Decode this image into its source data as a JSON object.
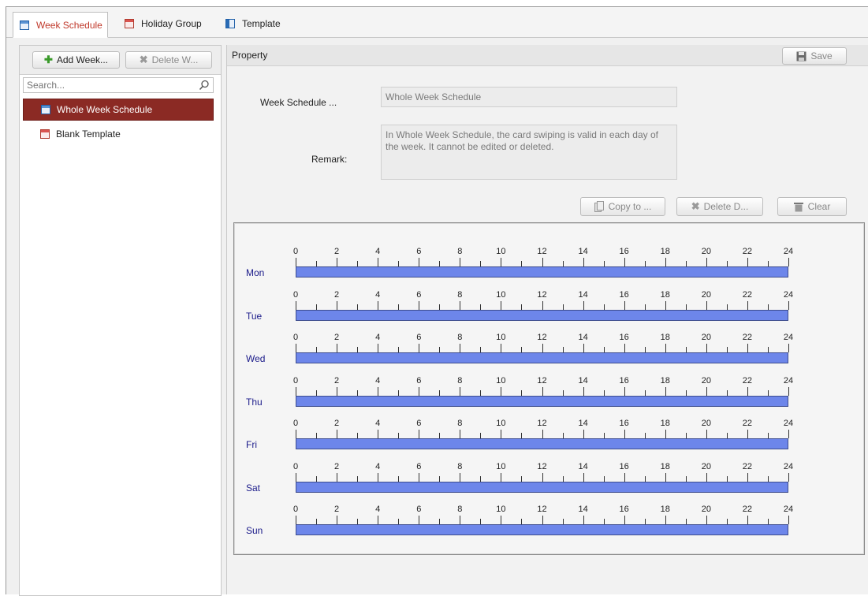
{
  "tabs": [
    {
      "label": "Week Schedule",
      "icon": "calendar-icon",
      "active": true
    },
    {
      "label": "Holiday Group",
      "icon": "holiday-calendar-icon",
      "active": false
    },
    {
      "label": "Template",
      "icon": "template-icon",
      "active": false
    }
  ],
  "left_panel": {
    "add_button": "Add Week...",
    "delete_button": "Delete W...",
    "search_placeholder": "Search...",
    "items": [
      {
        "label": "Whole Week Schedule",
        "selected": true
      },
      {
        "label": "Blank Template",
        "selected": false
      }
    ]
  },
  "property": {
    "title": "Property",
    "save_label": "Save",
    "name_label": "Week Schedule ...",
    "name_value": "Whole Week Schedule",
    "remark_label": "Remark:",
    "remark_value": "In Whole Week Schedule, the card swiping is valid in each day of the week. It cannot be edited or deleted."
  },
  "actions": {
    "copy_to": "Copy to ...",
    "delete_d": "Delete D...",
    "clear": "Clear"
  },
  "timeline": {
    "hour_labels": [
      "0",
      "2",
      "4",
      "6",
      "8",
      "10",
      "12",
      "14",
      "16",
      "18",
      "20",
      "22",
      "24"
    ],
    "days": [
      {
        "label": "Mon",
        "start": 0,
        "end": 24
      },
      {
        "label": "Tue",
        "start": 0,
        "end": 24
      },
      {
        "label": "Wed",
        "start": 0,
        "end": 24
      },
      {
        "label": "Thu",
        "start": 0,
        "end": 24
      },
      {
        "label": "Fri",
        "start": 0,
        "end": 24
      },
      {
        "label": "Sat",
        "start": 0,
        "end": 24
      },
      {
        "label": "Sun",
        "start": 0,
        "end": 24
      }
    ]
  },
  "colors": {
    "selected_item_bg": "#8b2a24",
    "bar_fill": "#6d86ea",
    "active_tab_text": "#c0392b",
    "day_label": "#1b1b8a"
  }
}
